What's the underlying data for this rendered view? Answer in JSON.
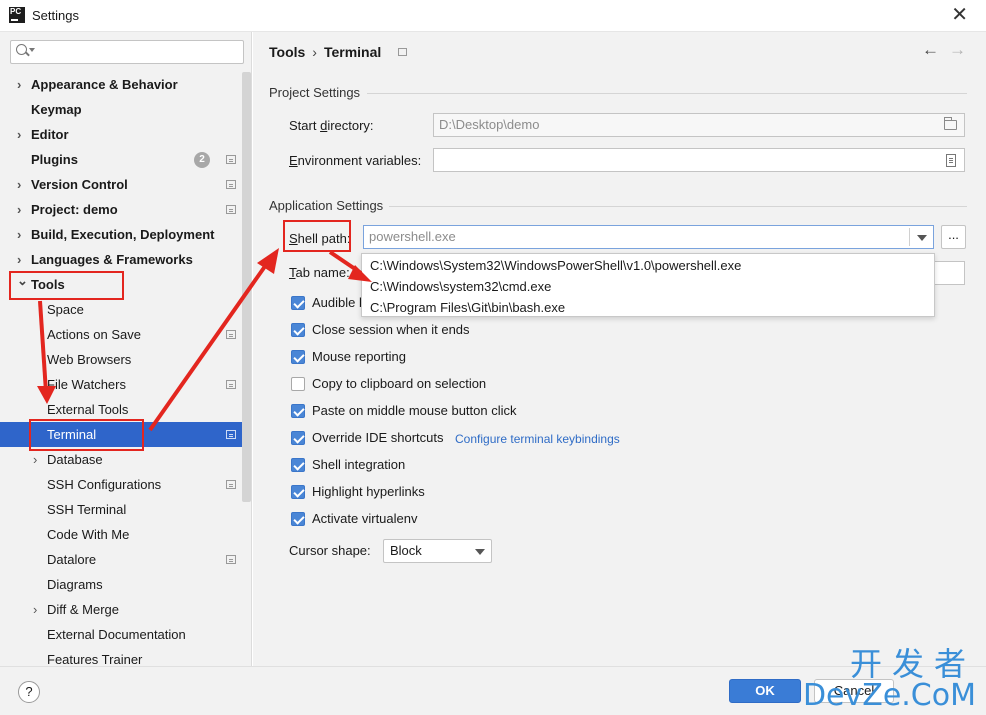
{
  "window": {
    "title": "Settings",
    "app_icon_text": "PC"
  },
  "search": {
    "placeholder": ""
  },
  "sidebar": {
    "items": [
      {
        "label": "Appearance & Behavior",
        "bold": true,
        "chevron": "collapsed"
      },
      {
        "label": "Keymap",
        "bold": true
      },
      {
        "label": "Editor",
        "bold": true,
        "chevron": "collapsed"
      },
      {
        "label": "Plugins",
        "bold": true,
        "badge": "2"
      },
      {
        "label": "Version Control",
        "bold": true,
        "chevron": "collapsed"
      },
      {
        "label": "Project: demo",
        "bold": true,
        "chevron": "collapsed"
      },
      {
        "label": "Build, Execution, Deployment",
        "bold": true,
        "chevron": "collapsed"
      },
      {
        "label": "Languages & Frameworks",
        "bold": true,
        "chevron": "collapsed"
      },
      {
        "label": "Tools",
        "bold": true,
        "chevron": "expanded"
      },
      {
        "label": "Space"
      },
      {
        "label": "Actions on Save"
      },
      {
        "label": "Web Browsers"
      },
      {
        "label": "File Watchers"
      },
      {
        "label": "External Tools"
      },
      {
        "label": "Terminal",
        "selected": true
      },
      {
        "label": "Database",
        "chevron": "collapsed"
      },
      {
        "label": "SSH Configurations"
      },
      {
        "label": "SSH Terminal"
      },
      {
        "label": "Code With Me"
      },
      {
        "label": "Datalore"
      },
      {
        "label": "Diagrams"
      },
      {
        "label": "Diff & Merge",
        "chevron": "collapsed"
      },
      {
        "label": "External Documentation"
      },
      {
        "label": "Features Trainer"
      }
    ]
  },
  "breadcrumb": {
    "parent": "Tools",
    "separator": "›",
    "current": "Terminal"
  },
  "project_settings": {
    "title": "Project Settings",
    "start_directory": {
      "label_pre": "Start ",
      "label_key": "d",
      "label_post": "irectory:",
      "value": "D:\\Desktop\\demo"
    },
    "environment_variables": {
      "label_key": "E",
      "label_post": "nvironment variables:",
      "value": ""
    }
  },
  "application_settings": {
    "title": "Application Settings",
    "shell_path": {
      "label_key": "S",
      "label_post": "hell path:",
      "value": "powershell.exe",
      "browse": "..."
    },
    "tab_name": {
      "label_key": "T",
      "label_post": "ab name:"
    },
    "checkboxes": [
      {
        "label": "Audible bell",
        "checked": true
      },
      {
        "label": "Close session when it ends",
        "checked": true
      },
      {
        "label": "Mouse reporting",
        "checked": true
      },
      {
        "label": "Copy to clipboard on selection",
        "checked": false
      },
      {
        "label": "Paste on middle mouse button click",
        "checked": true
      },
      {
        "label": "Override IDE shortcuts",
        "checked": true
      },
      {
        "label": "Shell integration",
        "checked": true
      },
      {
        "label": "Highlight hyperlinks",
        "checked": true
      },
      {
        "label": "Activate virtualenv",
        "checked": true
      }
    ],
    "configure_link": "Configure terminal keybindings",
    "cursor_shape": {
      "label": "Cursor shape:",
      "value": "Block"
    }
  },
  "shell_dropdown": {
    "options": [
      "C:\\Windows\\System32\\WindowsPowerShell\\v1.0\\powershell.exe",
      "C:\\Windows\\system32\\cmd.exe",
      "C:\\Program Files\\Git\\bin\\bash.exe"
    ]
  },
  "footer": {
    "help": "?",
    "ok": "OK",
    "cancel": "Cancel"
  },
  "watermark": {
    "cn": "开发者",
    "en": "DevZe.CoM"
  },
  "colors": {
    "accent": "#2f65ca",
    "annotation": "#e3261f",
    "ok_button": "#3a7cd6"
  }
}
